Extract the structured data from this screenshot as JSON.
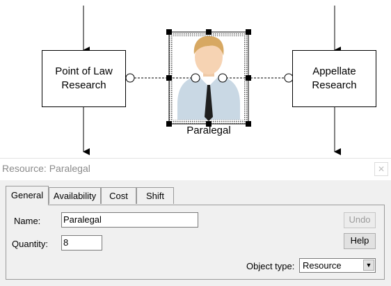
{
  "diagram": {
    "activities": [
      {
        "id": "point-of-law",
        "label": "Point of Law\nResearch"
      },
      {
        "id": "appellate",
        "label": "Appellate\nResearch"
      }
    ],
    "resource": {
      "label": "Paralegal",
      "icon": "person-icon"
    }
  },
  "dialog": {
    "title": "Resource: Paralegal",
    "close_icon": "close-icon",
    "tabs": [
      "General",
      "Availability",
      "Cost",
      "Shift"
    ],
    "active_tab": "General",
    "name_label": "Name:",
    "name_value": "Paralegal",
    "quantity_label": "Quantity:",
    "quantity_value": "8",
    "undo_label": "Undo",
    "help_label": "Help",
    "object_type_label": "Object type:",
    "object_type_value": "Resource"
  }
}
